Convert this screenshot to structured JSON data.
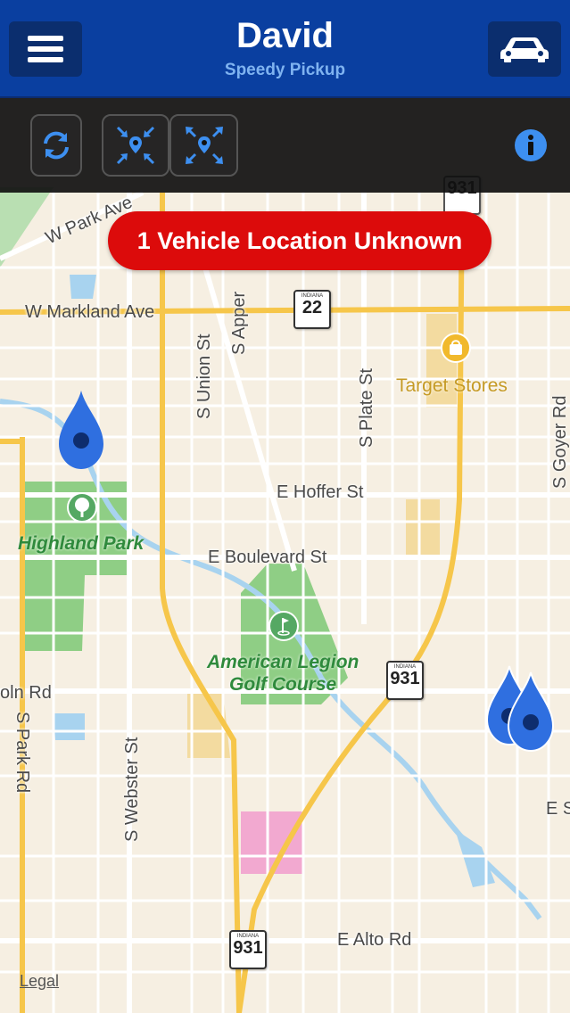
{
  "header": {
    "title": "David",
    "subtitle": "Speedy Pickup",
    "menu_icon": "hamburger-menu-icon",
    "vehicle_icon": "car-icon"
  },
  "toolbar": {
    "refresh_icon": "refresh-icon",
    "zoom_in_icon": "collapse-to-location-icon",
    "zoom_out_icon": "expand-from-location-icon",
    "info_icon": "info-icon"
  },
  "alert": {
    "text": "1 Vehicle Location Unknown"
  },
  "map": {
    "streets": {
      "w_park_ave": "W Park Ave",
      "w_markland_ave": "W Markland Ave",
      "s_union_st": "S Union St",
      "s_apperson": "S Apper",
      "s_plate_st": "S Plate St",
      "s_goyer_rd": "S Goyer Rd",
      "e_hoffer_st": "E Hoffer St",
      "e_boulevard_st": "E Boulevard St",
      "lincoln_rd": "oln Rd",
      "s_park_rd": "S Park Rd",
      "s_webster_st": "S Webster St",
      "e_alto_rd": "E Alto Rd",
      "e_sycamore": "E Sycamo",
      "e_s_right": "E S"
    },
    "places": {
      "highland_park": "Highland Park",
      "american_legion_1": "American Legion",
      "american_legion_2": "Golf Course",
      "target": "Target Stores"
    },
    "shields": [
      {
        "state": "",
        "number": "931"
      },
      {
        "state": "INDIANA",
        "number": "22"
      },
      {
        "state": "INDIANA",
        "number": "931"
      },
      {
        "state": "INDIANA",
        "number": "931"
      }
    ],
    "legal": "Legal"
  },
  "colors": {
    "header_bg": "#0a3fa0",
    "alert_bg": "#dc0b0b",
    "pin": "#2f6fe0"
  }
}
